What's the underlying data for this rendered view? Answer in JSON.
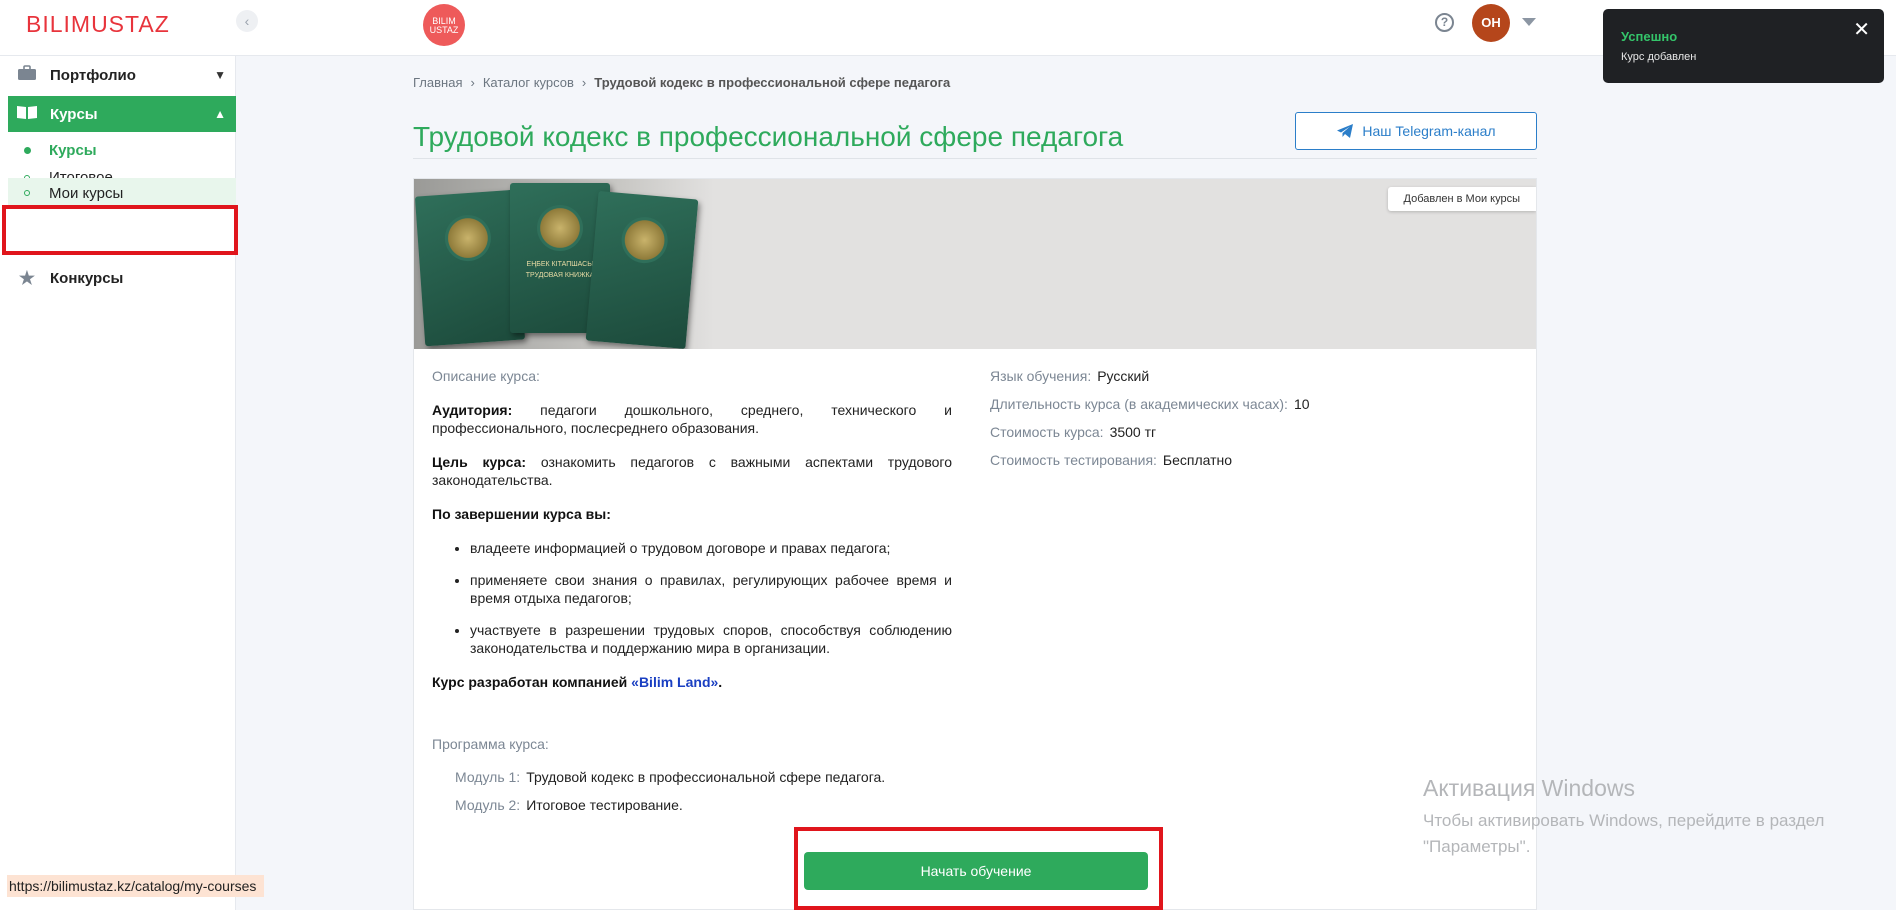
{
  "header": {
    "logo": "BILIMUSTAZ",
    "collapse_icon": "‹",
    "badge_line1": "BILIM",
    "badge_line2": "USTAZ",
    "help_icon": "?",
    "avatar_initials": "ОН"
  },
  "sidebar": {
    "portfolio": "Портфолио",
    "courses": "Курсы",
    "sub_courses": "Курсы",
    "sub_final_test": "Итоговое тестирование",
    "sub_my_courses": "Мои курсы",
    "contests": "Конкурсы"
  },
  "breadcrumb": [
    "Главная",
    "Каталог курсов",
    "Трудовой кодекс в профессиональной сфере педагога"
  ],
  "page_title": "Трудовой кодекс в профессиональной сфере педагога",
  "telegram_button": "Наш Telegram-канал",
  "banner": {
    "added_tag": "Добавлен в Мои курсы",
    "book_text_1": "ЕҢБЕК КІТАПШАСЫ",
    "book_text_2": "ТРУДОВАЯ КНИЖКА"
  },
  "description": {
    "heading": "Описание курса:",
    "audience_label": "Аудитория:",
    "audience_text": "педагоги дошкольного, среднего, технического и профессионального, послесреднего образования.",
    "goal_label": "Цель курса:",
    "goal_text": "ознакомить педагогов с важными аспектами трудового законодательства.",
    "outcomes_heading": "По завершении курса вы:",
    "outcomes": [
      "владеете информацией о трудовом договоре и правах педагога;",
      "применяете свои знания о правилах, регулирующих рабочее время и время отдыха педагогов;",
      "участвуете в разрешении трудовых споров, способствуя соблюдению законодательства и поддержанию мира в организации."
    ],
    "developer_prefix": "Курс разработан компанией",
    "developer_link": "«Bilim Land»",
    "developer_suffix": "."
  },
  "info": {
    "language_label": "Язык обучения:",
    "language_value": "Русский",
    "duration_label": "Длительность курса (в академических часах):",
    "duration_value": "10",
    "price_label": "Стоимость курса:",
    "price_value": "3500 тг",
    "test_price_label": "Стоимость тестирования:",
    "test_price_value": "Бесплатно"
  },
  "program": {
    "heading": "Программа курса:",
    "modules": [
      {
        "label": "Модуль 1:",
        "title": "Трудовой кодекс в профессиональной сфере педагога."
      },
      {
        "label": "Модуль 2:",
        "title": "Итоговое тестирование."
      }
    ]
  },
  "start_button": "Начать обучение",
  "toast": {
    "title": "Успешно",
    "message": "Курс добавлен",
    "close_icon": "✕"
  },
  "watermark": {
    "title": "Активация Windows",
    "line1": "Чтобы активировать Windows, перейдите в раздел",
    "line2": "\"Параметры\"."
  },
  "status_url": "https://bilimustaz.kz/catalog/my-courses",
  "colors": {
    "accent_green": "#2eaa5c",
    "brand_red": "#e8343c",
    "highlight_red": "#e0151c",
    "link_blue": "#2b7ec9"
  }
}
